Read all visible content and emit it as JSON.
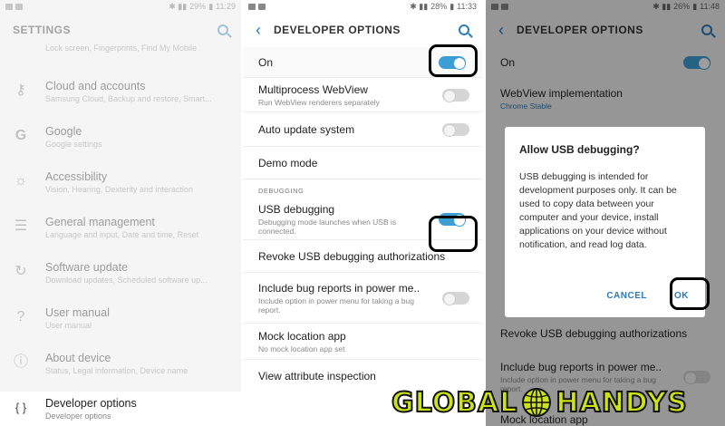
{
  "status": {
    "p1": {
      "battery": "29%",
      "time": "11:29"
    },
    "p2": {
      "battery": "28%",
      "time": "11:33"
    },
    "p3": {
      "battery": "26%",
      "time": "11:48"
    }
  },
  "settings": {
    "title": "SETTINGS",
    "items": [
      {
        "icon": "lock-icon",
        "title": "",
        "sub": "Lock screen, Fingerprints, Find My Mobile"
      },
      {
        "icon": "key-icon",
        "title": "Cloud and accounts",
        "sub": "Samsung Cloud, Backup and restore, Smart..."
      },
      {
        "icon": "google-icon",
        "title": "Google",
        "sub": "Google settings"
      },
      {
        "icon": "accessibility-icon",
        "title": "Accessibility",
        "sub": "Vision, Hearing, Dexterity and interaction"
      },
      {
        "icon": "sliders-icon",
        "title": "General management",
        "sub": "Language and input, Date and time, Reset"
      },
      {
        "icon": "update-icon",
        "title": "Software update",
        "sub": "Download updates, Scheduled software up..."
      },
      {
        "icon": "manual-icon",
        "title": "User manual",
        "sub": "User manual"
      },
      {
        "icon": "info-icon",
        "title": "About device",
        "sub": "Status, Legal information, Device name"
      }
    ],
    "dev": {
      "title": "Developer options",
      "sub": "Developer options",
      "icon_glyph": "{ }"
    }
  },
  "dev": {
    "title": "DEVELOPER OPTIONS",
    "on_label": "On",
    "multiprocess": {
      "title": "Multiprocess WebView",
      "sub": "Run WebView renderers separately"
    },
    "auto_update": {
      "title": "Auto update system"
    },
    "demo": {
      "title": "Demo mode"
    },
    "section_debugging": "DEBUGGING",
    "usb": {
      "title": "USB debugging",
      "sub": "Debugging mode launches when USB is connected."
    },
    "revoke": {
      "title": "Revoke USB debugging authorizations"
    },
    "bug_reports": {
      "title": "Include bug reports in power me..",
      "sub": "Include option in power menu for taking a bug report."
    },
    "mock": {
      "title": "Mock location app",
      "sub": "No mock location app set"
    },
    "view_attr": {
      "title": "View attribute inspection"
    }
  },
  "p3": {
    "title": "DEVELOPER OPTIONS",
    "on_label": "On",
    "webview": {
      "title": "WebView implementation",
      "value": "Chrome Stable"
    },
    "revoke": {
      "title": "Revoke USB debugging authorizations"
    },
    "bug_reports": {
      "title": "Include bug reports in power me..",
      "sub": "Include option in power menu for taking a bug report."
    },
    "mock": {
      "title": "Mock location app"
    },
    "dialog": {
      "title": "Allow USB debugging?",
      "body": "USB debugging is intended for development purposes only. It can be used to copy data between your computer and your device, install applications on your device without notification, and read log data.",
      "cancel": "CANCEL",
      "ok": "OK"
    }
  },
  "watermark": {
    "left": "GLOBAL",
    "right": "HANDYS"
  },
  "colors": {
    "accent": "#3d9ed6",
    "link": "#2b7bb9",
    "watermark": "#cde316"
  }
}
